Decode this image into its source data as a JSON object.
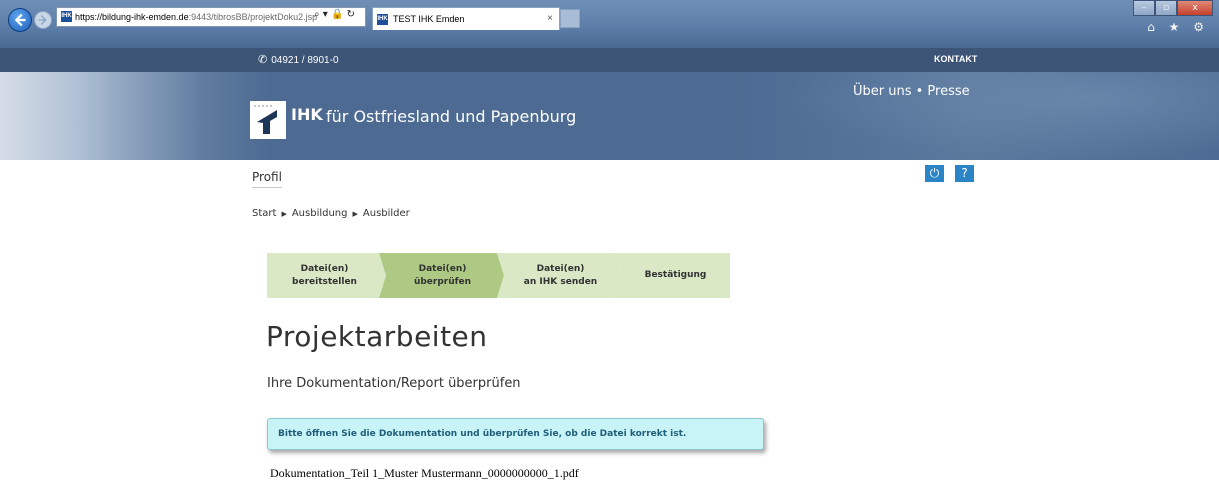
{
  "browser": {
    "address_host": "https://bildung-ihk-emden.de",
    "address_path": ":9443/tibrosBB/projektDoku2.jsp",
    "address_icons": "⌕ ▾ 🔒 ↻",
    "tab_title": "TEST IHK Emden",
    "tab_close": "×",
    "window_controls": [
      "–",
      "▫",
      "x"
    ],
    "tools": "⌂ ★ ⚙"
  },
  "header": {
    "phone": "04921 / 8901-0",
    "contact": "KONTAKT",
    "nav": "Über uns • Presse",
    "logo_mark": "IHK",
    "org_name": "für Ostfriesland und Papenburg"
  },
  "page": {
    "profile_link": "Profil",
    "buttons": {
      "power": "⏻",
      "help": "?"
    },
    "breadcrumb": [
      "Start",
      "Ausbildung",
      "Ausbilder"
    ],
    "steps": [
      {
        "line1": "Datei(en)",
        "line2": "bereitstellen",
        "active": false
      },
      {
        "line1": "Datei(en)",
        "line2": "überprüfen",
        "active": true
      },
      {
        "line1": "Datei(en)",
        "line2": "an IHK senden",
        "active": false
      },
      {
        "line1": "Bestätigung",
        "line2": "",
        "active": false
      }
    ],
    "title": "Projektarbeiten",
    "subtitle": "Ihre Dokumentation/Report überprüfen",
    "info_message": "Bitte öffnen Sie die Dokumentation und überprüfen Sie, ob die Datei korrekt ist.",
    "file_name": "Dokumentation_Teil 1_Muster Mustermann_0000000000_1.pdf"
  },
  "colors": {
    "step_inactive": "#dae8c5",
    "step_active": "#adc983",
    "accent_blue": "#2a84c6",
    "header_dark": "#3c5577"
  }
}
